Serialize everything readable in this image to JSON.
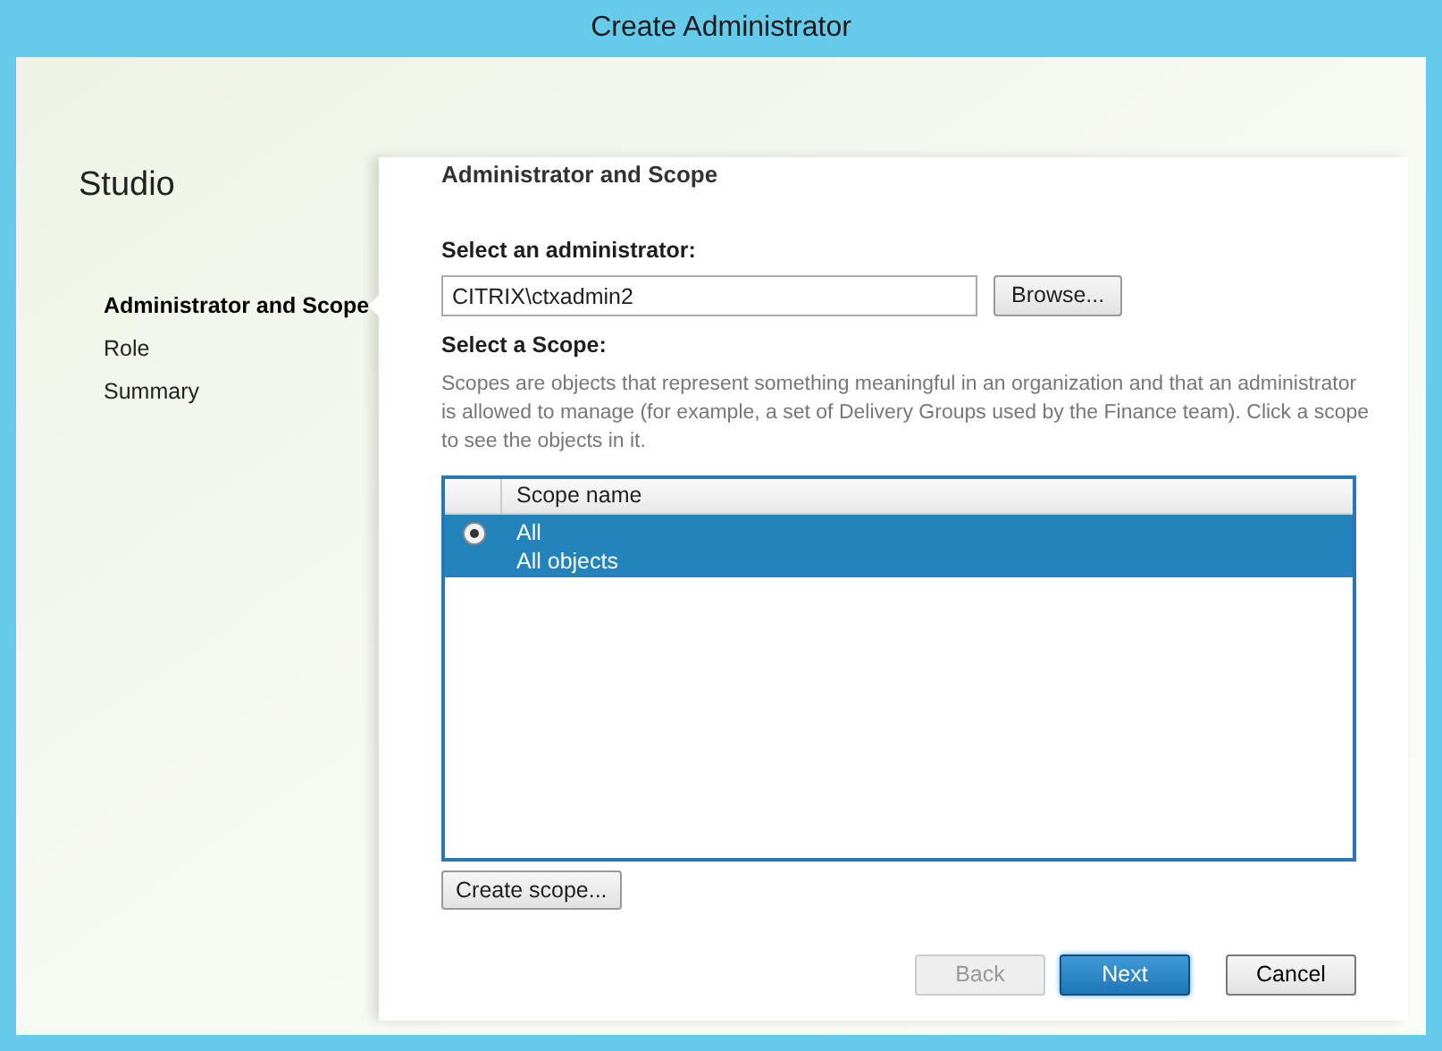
{
  "window": {
    "title": "Create Administrator"
  },
  "sidebar": {
    "title": "Studio",
    "items": [
      {
        "label": "Administrator and Scope",
        "selected": true
      },
      {
        "label": "Role",
        "selected": false
      },
      {
        "label": "Summary",
        "selected": false
      }
    ]
  },
  "page": {
    "heading": "Administrator and Scope",
    "admin_field": {
      "label": "Select an administrator:",
      "value": "CITRIX\\ctxadmin2"
    },
    "browse_button": "Browse...",
    "scope_label": "Select a Scope:",
    "scope_description": "Scopes are objects that represent something meaningful in an organization and that an administrator is allowed to manage (for example, a set of Delivery Groups used by the Finance team). Click a scope to see the objects in it.",
    "scope_table": {
      "columns": [
        "Scope name"
      ],
      "rows": [
        {
          "name": "All",
          "description": "All objects",
          "selected": true
        }
      ]
    },
    "create_scope_button": "Create scope..."
  },
  "buttons": [
    {
      "label": "Back",
      "disabled": true,
      "default": false
    },
    {
      "label": "Next",
      "disabled": false,
      "default": true
    },
    {
      "label": "Cancel",
      "disabled": false,
      "default": false
    }
  ]
}
